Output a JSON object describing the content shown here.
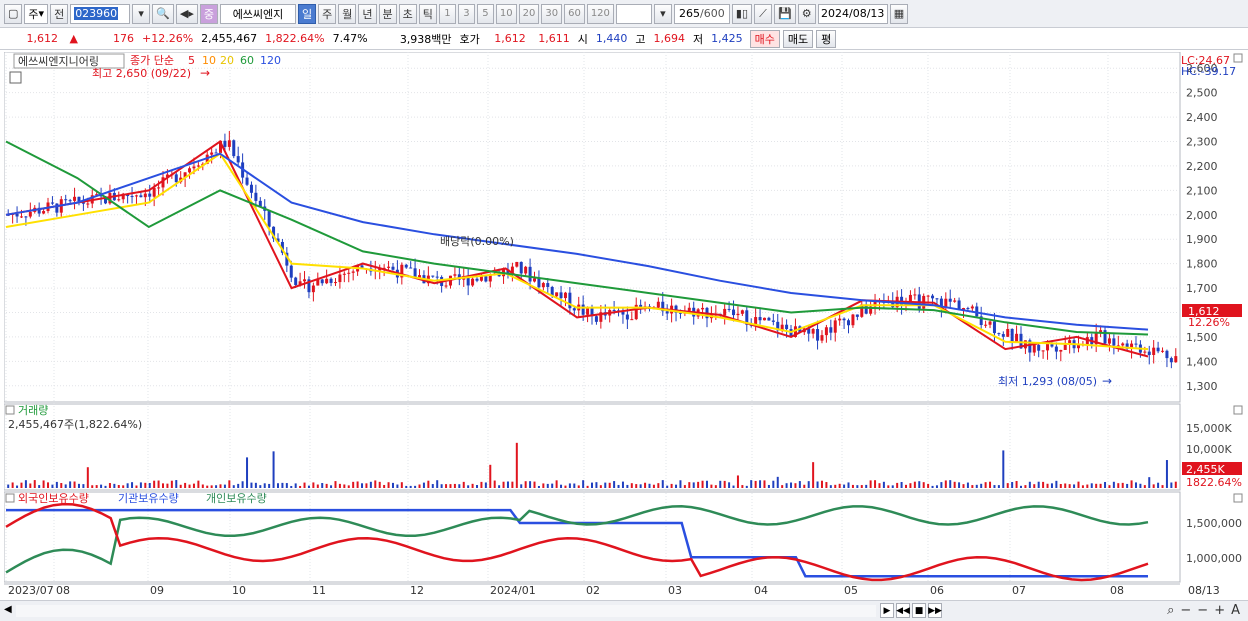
{
  "toolbar": {
    "period_type": "주",
    "prev_label": "전",
    "code": "023960",
    "stock_name": "에쓰씨엔지",
    "name_badge": "중",
    "periods": [
      "일",
      "주",
      "월",
      "년",
      "분",
      "초",
      "틱"
    ],
    "active_period": "일",
    "intervals": [
      "1",
      "3",
      "5",
      "10",
      "20",
      "30",
      "60",
      "120"
    ],
    "count": "265",
    "max_count": "/600",
    "date": "2024/08/13"
  },
  "quote": {
    "price": "1,612",
    "arrow": "▲",
    "change": "176",
    "change_pct": "+12.26%",
    "volume": "2,455,467",
    "volume_pct": "1,822.64%",
    "turnover": "7.47%",
    "amount": "3,938백만",
    "bid_label": "호가",
    "ask": "1,612",
    "bid": "1,611",
    "open_label": "시",
    "open": "1,440",
    "high_label": "고",
    "high": "1,694",
    "low_label": "저",
    "low": "1,425",
    "buy_label": "매수",
    "sell_label": "매도",
    "eval_label": "평"
  },
  "price_panel": {
    "name_label": "에쓰씨엔지니어링",
    "ma_label": "종가 단순",
    "ma_periods": [
      "5",
      "10",
      "20",
      "60",
      "120"
    ],
    "ma_colors": [
      "#e0141e",
      "#ff8c00",
      "#ffe000",
      "#1f9a3a",
      "#2a4fe0"
    ],
    "high_note": "최고 2,650 (09/22)",
    "low_note": "최저 1,293 (08/05)",
    "dividend_note": "배당락(0.00%)",
    "lc": "LC:24.67",
    "hc": "HC:-39.17",
    "current_price_tag": "1,612",
    "current_pct_tag": "12.26%"
  },
  "volume_panel": {
    "title": "거래량",
    "summary": "2,455,467주(1,822.64%)",
    "axis": [
      "15,000K",
      "10,000K",
      "5,000K"
    ],
    "current_tag": "2,455K",
    "current_pct": "1822.64%"
  },
  "holding_panel": {
    "series": [
      {
        "name": "외국인보유수량",
        "color": "#e0141e"
      },
      {
        "name": "기관보유수량",
        "color": "#2a4fe0"
      },
      {
        "name": "개인보유수량",
        "color": "#2e8b57"
      }
    ],
    "axis": [
      "1,500,000",
      "1,000,000"
    ]
  },
  "x_axis": [
    "2023/07",
    "08",
    "09",
    "10",
    "11",
    "12",
    "2024/01",
    "02",
    "03",
    "04",
    "05",
    "06",
    "07",
    "08",
    "08/13"
  ],
  "chart_data": {
    "type": "line",
    "y_axis_ticks": [
      "2,600",
      "2,500",
      "2,400",
      "2,300",
      "2,200",
      "2,100",
      "2,000",
      "1,900",
      "1,800",
      "1,700",
      "1,600",
      "1,500",
      "1,400",
      "1,300"
    ],
    "ylim": [
      1250,
      2650
    ],
    "months": [
      "2023/07",
      "08",
      "09",
      "10",
      "11",
      "12",
      "2024/01",
      "02",
      "03",
      "04",
      "05",
      "06",
      "07",
      "08"
    ],
    "series": [
      {
        "name": "5",
        "values": [
          2000,
          2050,
          2100,
          2300,
          1700,
          1800,
          1720,
          1780,
          1580,
          1620,
          1590,
          1500,
          1650,
          1640,
          1450,
          1500,
          1420
        ]
      },
      {
        "name": "20",
        "values": [
          1950,
          2000,
          2050,
          2250,
          1800,
          1780,
          1730,
          1760,
          1620,
          1620,
          1580,
          1520,
          1630,
          1630,
          1480,
          1470,
          1450
        ]
      },
      {
        "name": "60",
        "values": [
          2300,
          2150,
          1950,
          2100,
          1980,
          1850,
          1800,
          1760,
          1720,
          1680,
          1640,
          1600,
          1620,
          1610,
          1560,
          1520,
          1510
        ]
      },
      {
        "name": "120",
        "values": [
          2000,
          2050,
          2150,
          2250,
          2050,
          1970,
          1920,
          1880,
          1840,
          1790,
          1730,
          1680,
          1650,
          1630,
          1580,
          1550,
          1530
        ]
      }
    ]
  }
}
